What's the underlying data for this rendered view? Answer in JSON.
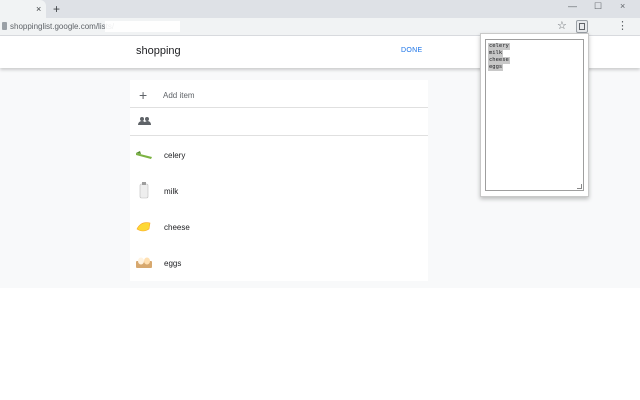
{
  "browser": {
    "tab_close": "×",
    "new_tab": "+",
    "url": "shoppinglist.google.com/lists/",
    "star": "☆",
    "menu": "⋮",
    "window_minimize": "—",
    "window_maximize": "☐",
    "window_close": "×"
  },
  "header": {
    "title": "shopping",
    "done_label": "DONE"
  },
  "list": {
    "add_icon": "+",
    "add_label": "Add item",
    "items": [
      {
        "label": "celery",
        "icon": "celery-icon"
      },
      {
        "label": "milk",
        "icon": "milk-icon"
      },
      {
        "label": "cheese",
        "icon": "cheese-icon"
      },
      {
        "label": "eggs",
        "icon": "eggs-icon"
      }
    ]
  },
  "popup": {
    "lines": [
      "celery",
      "milk",
      "cheese",
      "eggs"
    ]
  },
  "colors": {
    "accent": "#1a73e8",
    "page_bg": "#f8f9fa"
  }
}
